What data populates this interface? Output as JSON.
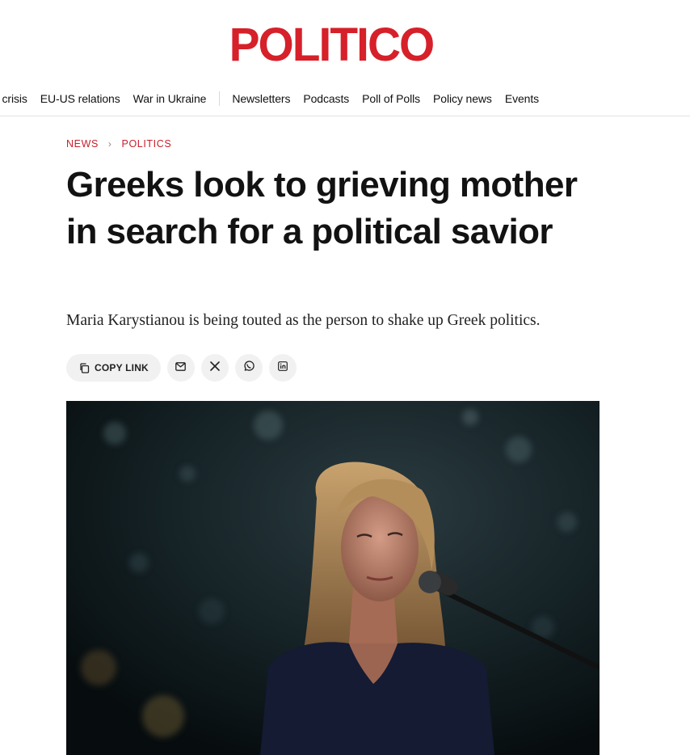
{
  "logo": "POLITICO",
  "nav": {
    "items_left": [
      "al crisis",
      "EU-US relations",
      "War in Ukraine"
    ],
    "items_right": [
      "Newsletters",
      "Podcasts",
      "Poll of Polls",
      "Policy news",
      "Events"
    ]
  },
  "breadcrumb": {
    "section": "NEWS",
    "subsection": "POLITICS"
  },
  "article": {
    "headline": "Greeks look to grieving mother in search for a political savior",
    "dek": "Maria Karystianou is being touted as the person to shake up Greek politics."
  },
  "share": {
    "copy_label": "COPY LINK",
    "icons": [
      "mail-icon",
      "x-icon",
      "whatsapp-icon",
      "linkedin-icon"
    ]
  },
  "colors": {
    "brand": "#d6202a",
    "crumb": "#c8202c",
    "button_bg": "#f1f1f1"
  }
}
